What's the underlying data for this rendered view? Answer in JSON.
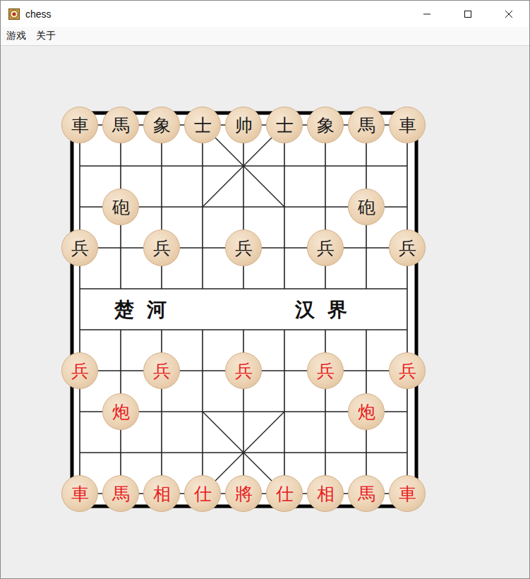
{
  "window": {
    "title": "chess"
  },
  "menu": [
    {
      "label": "游戏"
    },
    {
      "label": "关于"
    }
  ],
  "board": {
    "river": [
      "楚 河",
      "汉 界"
    ],
    "pieces": [
      {
        "label": "車",
        "col": 0,
        "row": 0,
        "color": "#1a1a1a"
      },
      {
        "label": "馬",
        "col": 1,
        "row": 0,
        "color": "#1a1a1a"
      },
      {
        "label": "象",
        "col": 2,
        "row": 0,
        "color": "#1a1a1a"
      },
      {
        "label": "士",
        "col": 3,
        "row": 0,
        "color": "#1a1a1a"
      },
      {
        "label": "帅",
        "col": 4,
        "row": 0,
        "color": "#1a1a1a"
      },
      {
        "label": "士",
        "col": 5,
        "row": 0,
        "color": "#1a1a1a"
      },
      {
        "label": "象",
        "col": 6,
        "row": 0,
        "color": "#1a1a1a"
      },
      {
        "label": "馬",
        "col": 7,
        "row": 0,
        "color": "#1a1a1a"
      },
      {
        "label": "車",
        "col": 8,
        "row": 0,
        "color": "#1a1a1a"
      },
      {
        "label": "砲",
        "col": 1,
        "row": 2,
        "color": "#1a1a1a"
      },
      {
        "label": "砲",
        "col": 7,
        "row": 2,
        "color": "#1a1a1a"
      },
      {
        "label": "兵",
        "col": 0,
        "row": 3,
        "color": "#1a1a1a"
      },
      {
        "label": "兵",
        "col": 2,
        "row": 3,
        "color": "#1a1a1a"
      },
      {
        "label": "兵",
        "col": 4,
        "row": 3,
        "color": "#1a1a1a"
      },
      {
        "label": "兵",
        "col": 6,
        "row": 3,
        "color": "#1a1a1a"
      },
      {
        "label": "兵",
        "col": 8,
        "row": 3,
        "color": "#1a1a1a"
      },
      {
        "label": "兵",
        "col": 0,
        "row": 6,
        "color": "#e8201c"
      },
      {
        "label": "兵",
        "col": 2,
        "row": 6,
        "color": "#e8201c"
      },
      {
        "label": "兵",
        "col": 4,
        "row": 6,
        "color": "#e8201c"
      },
      {
        "label": "兵",
        "col": 6,
        "row": 6,
        "color": "#e8201c"
      },
      {
        "label": "兵",
        "col": 8,
        "row": 6,
        "color": "#e8201c"
      },
      {
        "label": "炮",
        "col": 1,
        "row": 7,
        "color": "#e8201c"
      },
      {
        "label": "炮",
        "col": 7,
        "row": 7,
        "color": "#e8201c"
      },
      {
        "label": "車",
        "col": 0,
        "row": 9,
        "color": "#e8201c"
      },
      {
        "label": "馬",
        "col": 1,
        "row": 9,
        "color": "#e8201c"
      },
      {
        "label": "相",
        "col": 2,
        "row": 9,
        "color": "#e8201c"
      },
      {
        "label": "仕",
        "col": 3,
        "row": 9,
        "color": "#e8201c"
      },
      {
        "label": "將",
        "col": 4,
        "row": 9,
        "color": "#e8201c"
      },
      {
        "label": "仕",
        "col": 5,
        "row": 9,
        "color": "#e8201c"
      },
      {
        "label": "相",
        "col": 6,
        "row": 9,
        "color": "#e8201c"
      },
      {
        "label": "馬",
        "col": 7,
        "row": 9,
        "color": "#e8201c"
      },
      {
        "label": "車",
        "col": 8,
        "row": 9,
        "color": "#e8201c"
      }
    ]
  }
}
